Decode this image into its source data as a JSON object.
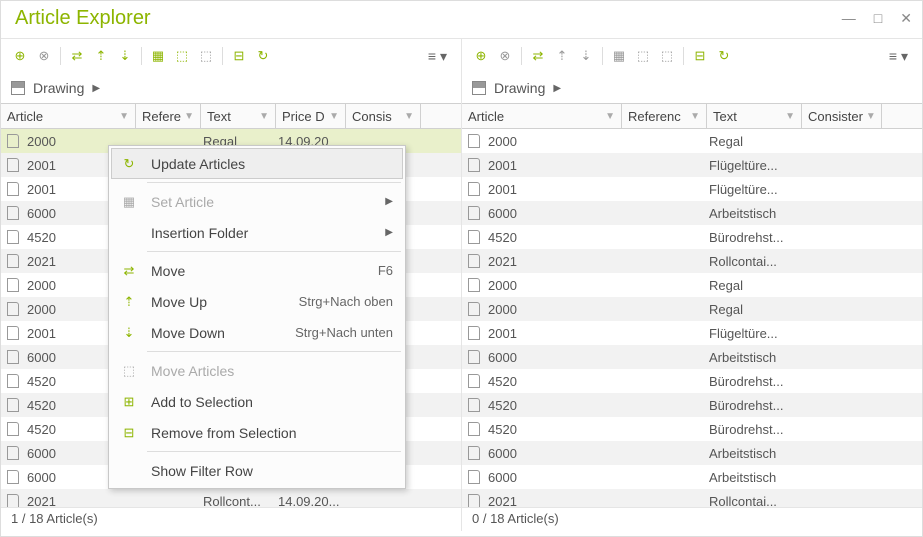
{
  "window": {
    "title": "Article Explorer"
  },
  "breadcrumb": {
    "label": "Drawing"
  },
  "left": {
    "cols": [
      "Article",
      "Refere",
      "Text",
      "Price D",
      "Consis"
    ],
    "rows": [
      {
        "a": "2000",
        "t": "Regal",
        "d": "14.09.20"
      },
      {
        "a": "2001",
        "t": "",
        "d": ""
      },
      {
        "a": "2001",
        "t": "",
        "d": ""
      },
      {
        "a": "6000",
        "t": "",
        "d": ""
      },
      {
        "a": "4520",
        "t": "",
        "d": ""
      },
      {
        "a": "2021",
        "t": "",
        "d": ""
      },
      {
        "a": "2000",
        "t": "",
        "d": ""
      },
      {
        "a": "2000",
        "t": "",
        "d": ""
      },
      {
        "a": "2001",
        "t": "",
        "d": ""
      },
      {
        "a": "6000",
        "t": "",
        "d": ""
      },
      {
        "a": "4520",
        "t": "",
        "d": ""
      },
      {
        "a": "4520",
        "t": "",
        "d": ""
      },
      {
        "a": "4520",
        "t": "",
        "d": ""
      },
      {
        "a": "6000",
        "t": "",
        "d": ""
      },
      {
        "a": "6000",
        "t": "",
        "d": ""
      },
      {
        "a": "2021",
        "t": "Rollcont...",
        "d": "14.09.20..."
      }
    ],
    "status": "1 / 18 Article(s)"
  },
  "right": {
    "cols": [
      "Article",
      "Referenc",
      "Text",
      "Consister"
    ],
    "rows": [
      {
        "a": "2000",
        "t": "Regal"
      },
      {
        "a": "2001",
        "t": "Flügeltüre..."
      },
      {
        "a": "2001",
        "t": "Flügeltüre..."
      },
      {
        "a": "6000",
        "t": "Arbeitstisch"
      },
      {
        "a": "4520",
        "t": "Bürodrehst..."
      },
      {
        "a": "2021",
        "t": "Rollcontai..."
      },
      {
        "a": "2000",
        "t": "Regal"
      },
      {
        "a": "2000",
        "t": "Regal"
      },
      {
        "a": "2001",
        "t": "Flügeltüre..."
      },
      {
        "a": "6000",
        "t": "Arbeitstisch"
      },
      {
        "a": "4520",
        "t": "Bürodrehst..."
      },
      {
        "a": "4520",
        "t": "Bürodrehst..."
      },
      {
        "a": "4520",
        "t": "Bürodrehst..."
      },
      {
        "a": "6000",
        "t": "Arbeitstisch"
      },
      {
        "a": "6000",
        "t": "Arbeitstisch"
      },
      {
        "a": "2021",
        "t": "Rollcontai..."
      }
    ],
    "status": "0 / 18 Article(s)"
  },
  "menu": {
    "update": "Update Articles",
    "set": "Set Article",
    "folder": "Insertion Folder",
    "move": "Move",
    "move_sc": "F6",
    "moveup": "Move Up",
    "moveup_sc": "Strg+Nach oben",
    "movedown": "Move Down",
    "movedown_sc": "Strg+Nach unten",
    "movea": "Move Articles",
    "add": "Add to Selection",
    "remove": "Remove from Selection",
    "filter": "Show Filter Row"
  }
}
